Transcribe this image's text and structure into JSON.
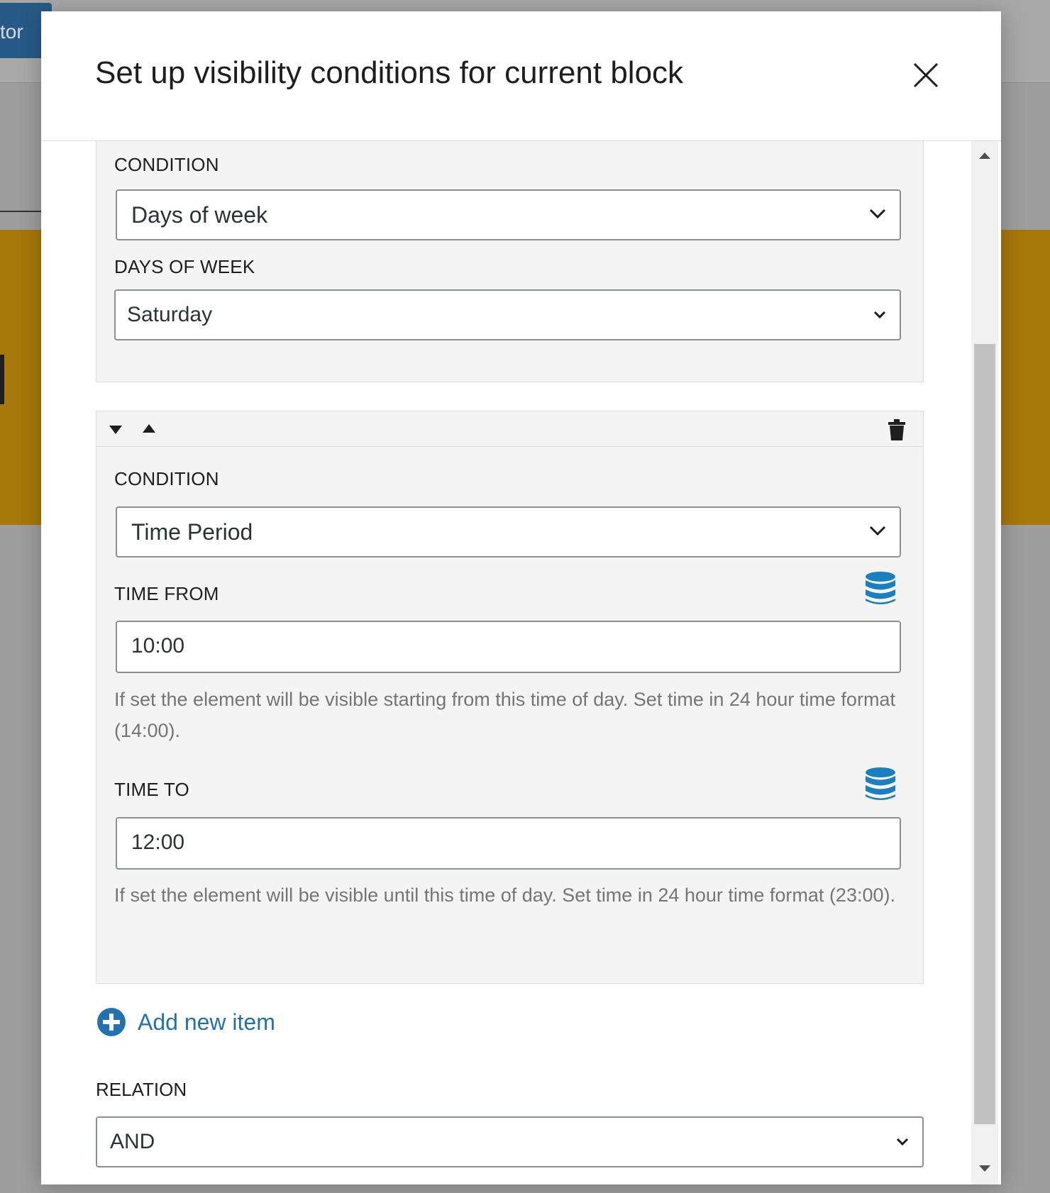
{
  "background": {
    "editor_button_label": "tor"
  },
  "modal": {
    "title": "Set up visibility conditions for current block",
    "close_icon": "close-icon"
  },
  "conditions": [
    {
      "condition_label": "CONDITION",
      "condition_value": "Days of week",
      "days_label": "DAYS OF WEEK",
      "days_value": "Saturday"
    },
    {
      "condition_label": "CONDITION",
      "condition_value": "Time Period",
      "time_from_label": "TIME FROM",
      "time_from_value": "10:00",
      "time_from_help": "If set the element will be visible starting from this time of day. Set time in 24 hour time format (14:00).",
      "time_to_label": "TIME TO",
      "time_to_value": "12:00",
      "time_to_help": "If set the element will be visible until this time of day. Set time in 24 hour time format (23:00)."
    }
  ],
  "add_new_item_label": "Add new item",
  "relation": {
    "label": "RELATION",
    "value": "AND"
  },
  "colors": {
    "accent": "#2271b1",
    "dynamic_icon": "#1a7fc1",
    "background_yellow": "#a7780a",
    "editor_button": "#285a87"
  }
}
